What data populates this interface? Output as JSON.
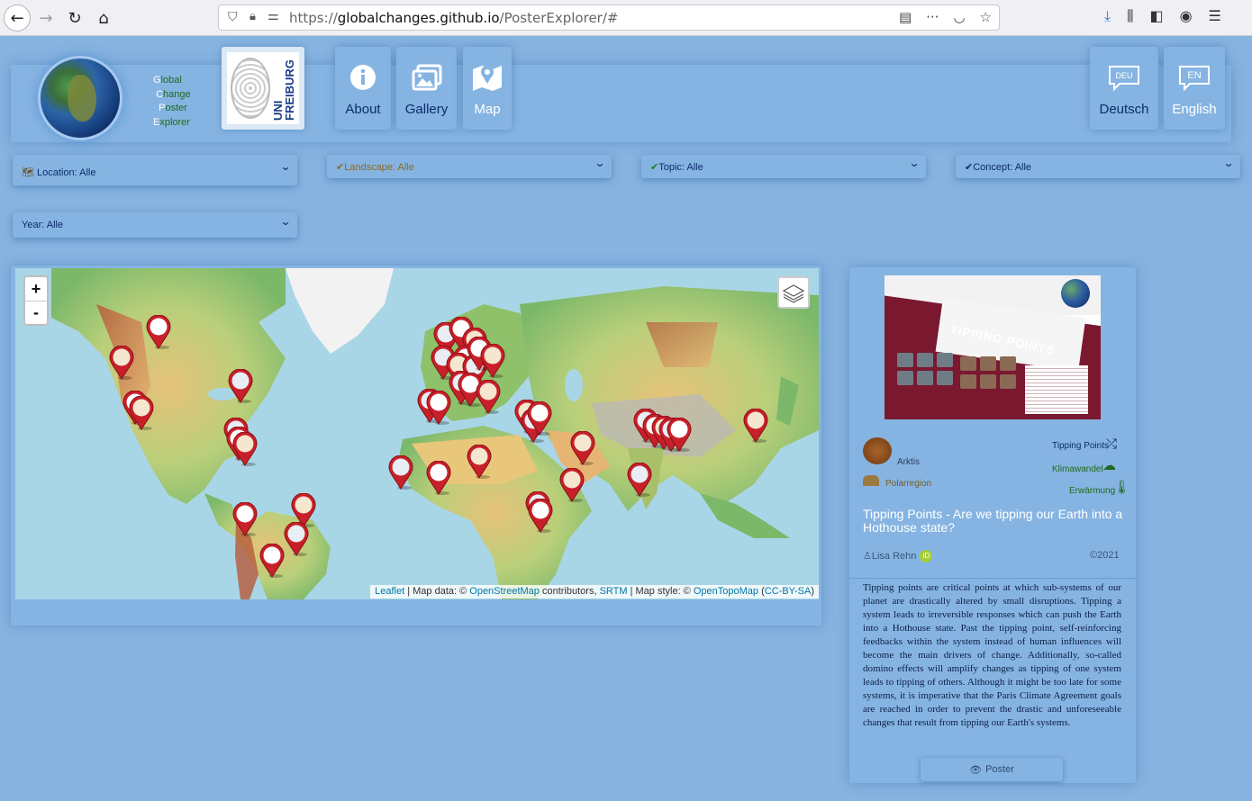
{
  "browser": {
    "url_prefix": "https://",
    "url_host": "globalchanges.github.io",
    "url_path": "/PosterExplorer/#"
  },
  "brand": {
    "lines": [
      {
        "initial": "G",
        "rest": "lobal"
      },
      {
        "initial": "C",
        "rest": "hange"
      },
      {
        "initial": "P",
        "rest": "oster"
      },
      {
        "initial": "E",
        "rest": "xplorer"
      }
    ],
    "uni_text": "UNI FREIBURG"
  },
  "nav": {
    "about": "About",
    "gallery": "Gallery",
    "map": "Map",
    "deutsch": "Deutsch",
    "deu_badge": "DEU",
    "english": "English",
    "en_badge": "EN"
  },
  "filters": {
    "location": "Location: Alle",
    "landscape": "Landscape: Alle",
    "topic": "Topic: Alle",
    "concept": "Concept: Alle",
    "year": "Year: Alle"
  },
  "map": {
    "zoom_in": "+",
    "zoom_out": "-",
    "attribution": {
      "leaflet": "Leaflet",
      "sep1": " | Map data: © ",
      "osm": "OpenStreetMap",
      "contributors": " contributors, ",
      "srtm": "SRTM",
      "sep2": " | Map style: © ",
      "opentopomap": "OpenTopoMap",
      "ccbysa": "CC-BY-SA"
    }
  },
  "poster": {
    "image_title": "TIPPING POINTS",
    "location_tag": "Arktis",
    "landscape_tag": "Polarregion",
    "topic_tag": "Tipping Points",
    "concept_tag1": "Klimawandel",
    "concept_tag2": "Erwärmung",
    "title": "Tipping Points - Are we tipping our Earth into a Hothouse state?",
    "author": "Lisa Rehn",
    "orcid": "iD",
    "year": "©2021",
    "description": "Tipping points are critical points at which sub-systems of our planet are drastically altered by small disruptions. Tipping a system leads to irreversible responses which can push the Earth into a Hothouse state. Past the tipping point, self-reinforcing feedbacks within the system instead of human influences will become the main drivers of change. Additionally, so-called domino effects will amplify changes as tipping of one system leads to tipping of others. Although it might be too late for some systems, it is imperative that the Paris Climate Agreement goals are reached in order to prevent the drastic and unforeseeable changes that result from tipping our Earth's systems.",
    "button": "Poster"
  },
  "colors": {
    "page_bg": "#86b3e0",
    "nav_text": "#0c2b6b",
    "marker_red": "#c8202a",
    "brand_green": "#1d6b1d"
  }
}
